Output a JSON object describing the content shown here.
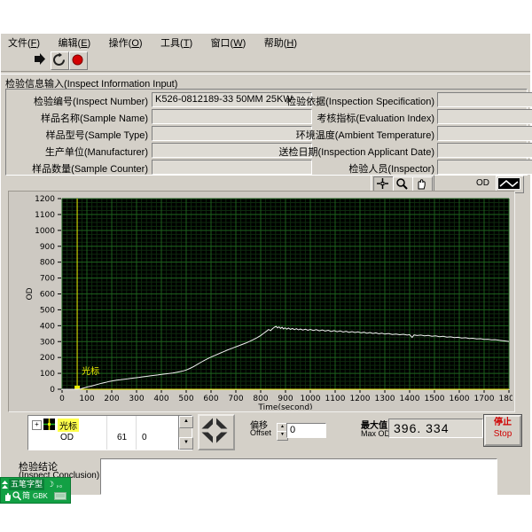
{
  "menu": {
    "items": [
      {
        "pre": "文件(",
        "key": "F",
        "post": ")"
      },
      {
        "pre": "编辑(",
        "key": "E",
        "post": ")"
      },
      {
        "pre": "操作(",
        "key": "O",
        "post": ")"
      },
      {
        "pre": "工具(",
        "key": "T",
        "post": ")"
      },
      {
        "pre": "窗口(",
        "key": "W",
        "post": ")"
      },
      {
        "pre": "帮助(",
        "key": "H",
        "post": ")"
      }
    ]
  },
  "toolbar": {
    "icons": {
      "run": "black-right-arrow",
      "continuous_run": "circular-arrows",
      "abort": "red-filled-circle"
    }
  },
  "section": {
    "title": "检验信息输入(Inspect Information Input)"
  },
  "form": {
    "left": [
      {
        "label": "检验编号(Inspect Number)",
        "value": "K526-0812189-33 50MM 25KW"
      },
      {
        "label": "样品名称(Sample Name)",
        "value": ""
      },
      {
        "label": "样品型号(Sample Type)",
        "value": ""
      },
      {
        "label": "生产单位(Manufacturer)",
        "value": ""
      },
      {
        "label": "样品数量(Sample Counter)",
        "value": ""
      }
    ],
    "right": [
      {
        "label": "检验依据(Inspection Specification)",
        "value": ""
      },
      {
        "label": "考核指标(Evaluation Index)",
        "value": ""
      },
      {
        "label": "环境温度(Ambient Temperature)",
        "value": ""
      },
      {
        "label": "送检日期(Inspection Applicant Date)",
        "value": ""
      },
      {
        "label": "检验人员(Inspector)",
        "value": ""
      }
    ]
  },
  "chart_panel": {
    "palette_icons": [
      "crosshair",
      "zoom-magnifier",
      "pan-hand"
    ],
    "legend": {
      "series": "OD"
    }
  },
  "chart_data": {
    "type": "line",
    "title": "",
    "xlabel": "Time(second)",
    "ylabel": "OD",
    "xlim": [
      0,
      1800
    ],
    "ylim": [
      0,
      1200
    ],
    "x_major": 100,
    "x_minor": 20,
    "y_major": 100,
    "y_minor": 25,
    "grid": true,
    "legend_position": "top-right",
    "colors": {
      "bg": "#000000",
      "minor": "#0e2b0e",
      "major": "#1d5f1d",
      "curve": "#f0f0f0",
      "axis": "#e8e800",
      "cursor": "#ecec00",
      "tick_text": "#000000"
    },
    "cursor": {
      "label": "光标",
      "x": 61,
      "y": 0
    },
    "max_od": 396.334,
    "series": [
      {
        "name": "OD",
        "color": "#f0f0f0",
        "points": [
          [
            0,
            0
          ],
          [
            30,
            0
          ],
          [
            61,
            0
          ],
          [
            75,
            2
          ],
          [
            90,
            9
          ],
          [
            100,
            14
          ],
          [
            115,
            19
          ],
          [
            130,
            25
          ],
          [
            145,
            32
          ],
          [
            160,
            38
          ],
          [
            175,
            43
          ],
          [
            190,
            49
          ],
          [
            205,
            53
          ],
          [
            220,
            57
          ],
          [
            235,
            60
          ],
          [
            250,
            63
          ],
          [
            265,
            66
          ],
          [
            280,
            69
          ],
          [
            295,
            72
          ],
          [
            310,
            75
          ],
          [
            325,
            78
          ],
          [
            340,
            81
          ],
          [
            355,
            84
          ],
          [
            370,
            87
          ],
          [
            385,
            90
          ],
          [
            400,
            93
          ],
          [
            415,
            96
          ],
          [
            430,
            99
          ],
          [
            445,
            102
          ],
          [
            460,
            106
          ],
          [
            475,
            111
          ],
          [
            490,
            116
          ],
          [
            500,
            121
          ],
          [
            515,
            131
          ],
          [
            530,
            143
          ],
          [
            545,
            157
          ],
          [
            560,
            170
          ],
          [
            575,
            183
          ],
          [
            590,
            195
          ],
          [
            605,
            206
          ],
          [
            620,
            216
          ],
          [
            635,
            226
          ],
          [
            650,
            236
          ],
          [
            665,
            246
          ],
          [
            680,
            255
          ],
          [
            695,
            264
          ],
          [
            710,
            273
          ],
          [
            725,
            282
          ],
          [
            740,
            291
          ],
          [
            755,
            301
          ],
          [
            770,
            312
          ],
          [
            785,
            324
          ],
          [
            800,
            338
          ],
          [
            812,
            352
          ],
          [
            822,
            364
          ],
          [
            832,
            376
          ],
          [
            840,
            369
          ],
          [
            848,
            382
          ],
          [
            856,
            391
          ],
          [
            862,
            396
          ],
          [
            868,
            386
          ],
          [
            874,
            393
          ],
          [
            880,
            383
          ],
          [
            886,
            390
          ],
          [
            892,
            380
          ],
          [
            898,
            387
          ],
          [
            905,
            379
          ],
          [
            912,
            385
          ],
          [
            920,
            377
          ],
          [
            928,
            383
          ],
          [
            936,
            375
          ],
          [
            944,
            381
          ],
          [
            952,
            374
          ],
          [
            960,
            379
          ],
          [
            970,
            373
          ],
          [
            980,
            378
          ],
          [
            990,
            371
          ],
          [
            1000,
            377
          ],
          [
            1012,
            370
          ],
          [
            1024,
            375
          ],
          [
            1036,
            368
          ],
          [
            1048,
            373
          ],
          [
            1060,
            366
          ],
          [
            1072,
            371
          ],
          [
            1084,
            364
          ],
          [
            1096,
            369
          ],
          [
            1108,
            362
          ],
          [
            1120,
            367
          ],
          [
            1132,
            360
          ],
          [
            1144,
            365
          ],
          [
            1156,
            358
          ],
          [
            1168,
            363
          ],
          [
            1180,
            357
          ],
          [
            1192,
            361
          ],
          [
            1204,
            355
          ],
          [
            1216,
            359
          ],
          [
            1228,
            353
          ],
          [
            1240,
            357
          ],
          [
            1252,
            351
          ],
          [
            1264,
            355
          ],
          [
            1276,
            349
          ],
          [
            1288,
            353
          ],
          [
            1300,
            347
          ],
          [
            1315,
            351
          ],
          [
            1330,
            345
          ],
          [
            1345,
            348
          ],
          [
            1360,
            343
          ],
          [
            1375,
            346
          ],
          [
            1390,
            341
          ],
          [
            1400,
            344
          ],
          [
            1410,
            326
          ],
          [
            1418,
            342
          ],
          [
            1430,
            338
          ],
          [
            1445,
            341
          ],
          [
            1460,
            336
          ],
          [
            1475,
            339
          ],
          [
            1490,
            334
          ],
          [
            1505,
            336
          ],
          [
            1520,
            331
          ],
          [
            1535,
            333
          ],
          [
            1550,
            328
          ],
          [
            1565,
            330
          ],
          [
            1580,
            325
          ],
          [
            1595,
            327
          ],
          [
            1610,
            322
          ],
          [
            1625,
            324
          ],
          [
            1640,
            319
          ],
          [
            1655,
            321
          ],
          [
            1670,
            317
          ],
          [
            1685,
            318
          ],
          [
            1700,
            314
          ],
          [
            1715,
            315
          ],
          [
            1730,
            311
          ],
          [
            1745,
            312
          ],
          [
            1760,
            308
          ],
          [
            1775,
            306
          ],
          [
            1790,
            303
          ],
          [
            1800,
            301
          ]
        ]
      }
    ]
  },
  "cursor_panel": {
    "cursor_label": "光标",
    "series": "OD",
    "x": "61",
    "y": "0",
    "expander": "+"
  },
  "controls": {
    "offset": {
      "cn": "偏移",
      "en": "Offset",
      "value": "0"
    },
    "max": {
      "cn": "最大值",
      "en": "Max OD",
      "value": "396. 334"
    },
    "stop": {
      "cn": "停止",
      "en": "Stop"
    }
  },
  "conclusion": {
    "cn": "检验结论",
    "en": "(Inspect Conclusion)",
    "text": ""
  },
  "ime": {
    "name": "五笔字型",
    "simplified": "简",
    "encoding": "GBK",
    "moon": "☽",
    "punct": "，。"
  }
}
